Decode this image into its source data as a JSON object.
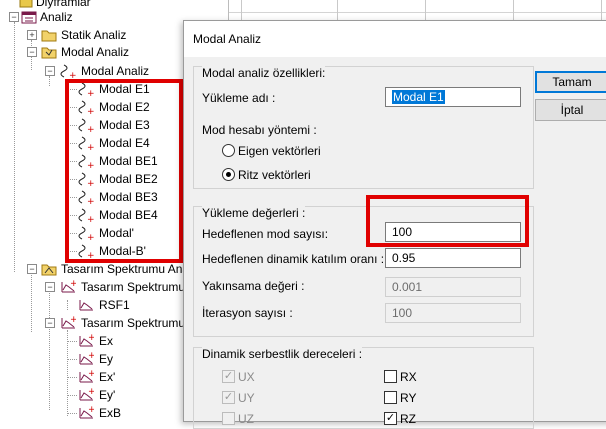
{
  "tree": {
    "top_partial": "Diyframlar",
    "analiz": "Analiz",
    "statik": "Statik Analiz",
    "modal_group": "Modal Analiz",
    "modal_node": "Modal Analiz",
    "modal_items": [
      "Modal E1",
      "Modal E2",
      "Modal E3",
      "Modal E4",
      "Modal BE1",
      "Modal BE2",
      "Modal BE3",
      "Modal BE4",
      "Modal'",
      "Modal-B'"
    ],
    "spectrum_group": "Tasarım Spektrumu Ana",
    "spectrum_1": "Tasarım Spektrumu",
    "rsf": "RSF1",
    "spectrum_2": "Tasarım Spektrumu",
    "spectrum_items": [
      "Ex",
      "Ey",
      "Ex'",
      "Ey'",
      "ExB"
    ]
  },
  "dialog": {
    "title": "Modal Analiz",
    "props_group": "Modal analiz özellikleri:",
    "load_name_label": "Yükleme adı :",
    "load_name_value": "Modal E1",
    "method_label": "Mod hesabı yöntemi :",
    "radio_eigen": "Eigen vektörleri",
    "radio_ritz": "Ritz vektörleri",
    "values_group": "Yükleme değerleri :",
    "target_modes_label": "Hedeflenen mod sayısı:",
    "target_modes_value": "100",
    "mass_ratio_label": "Hedeflenen dinamik katılım oranı :",
    "mass_ratio_value": "0.95",
    "convergence_label": "Yakınsama değeri :",
    "convergence_value": "0.001",
    "iteration_label": "İterasyon sayısı :",
    "iteration_value": "100",
    "dof_group": "Dinamik serbestlik dereceleri :",
    "dof": [
      "UX",
      "UY",
      "UZ",
      "RX",
      "RY",
      "RZ"
    ],
    "ok_button": "Tamam",
    "cancel_button": "İptal"
  },
  "colors": {
    "highlight_red": "#e00000",
    "selection_blue": "#0078d7"
  }
}
